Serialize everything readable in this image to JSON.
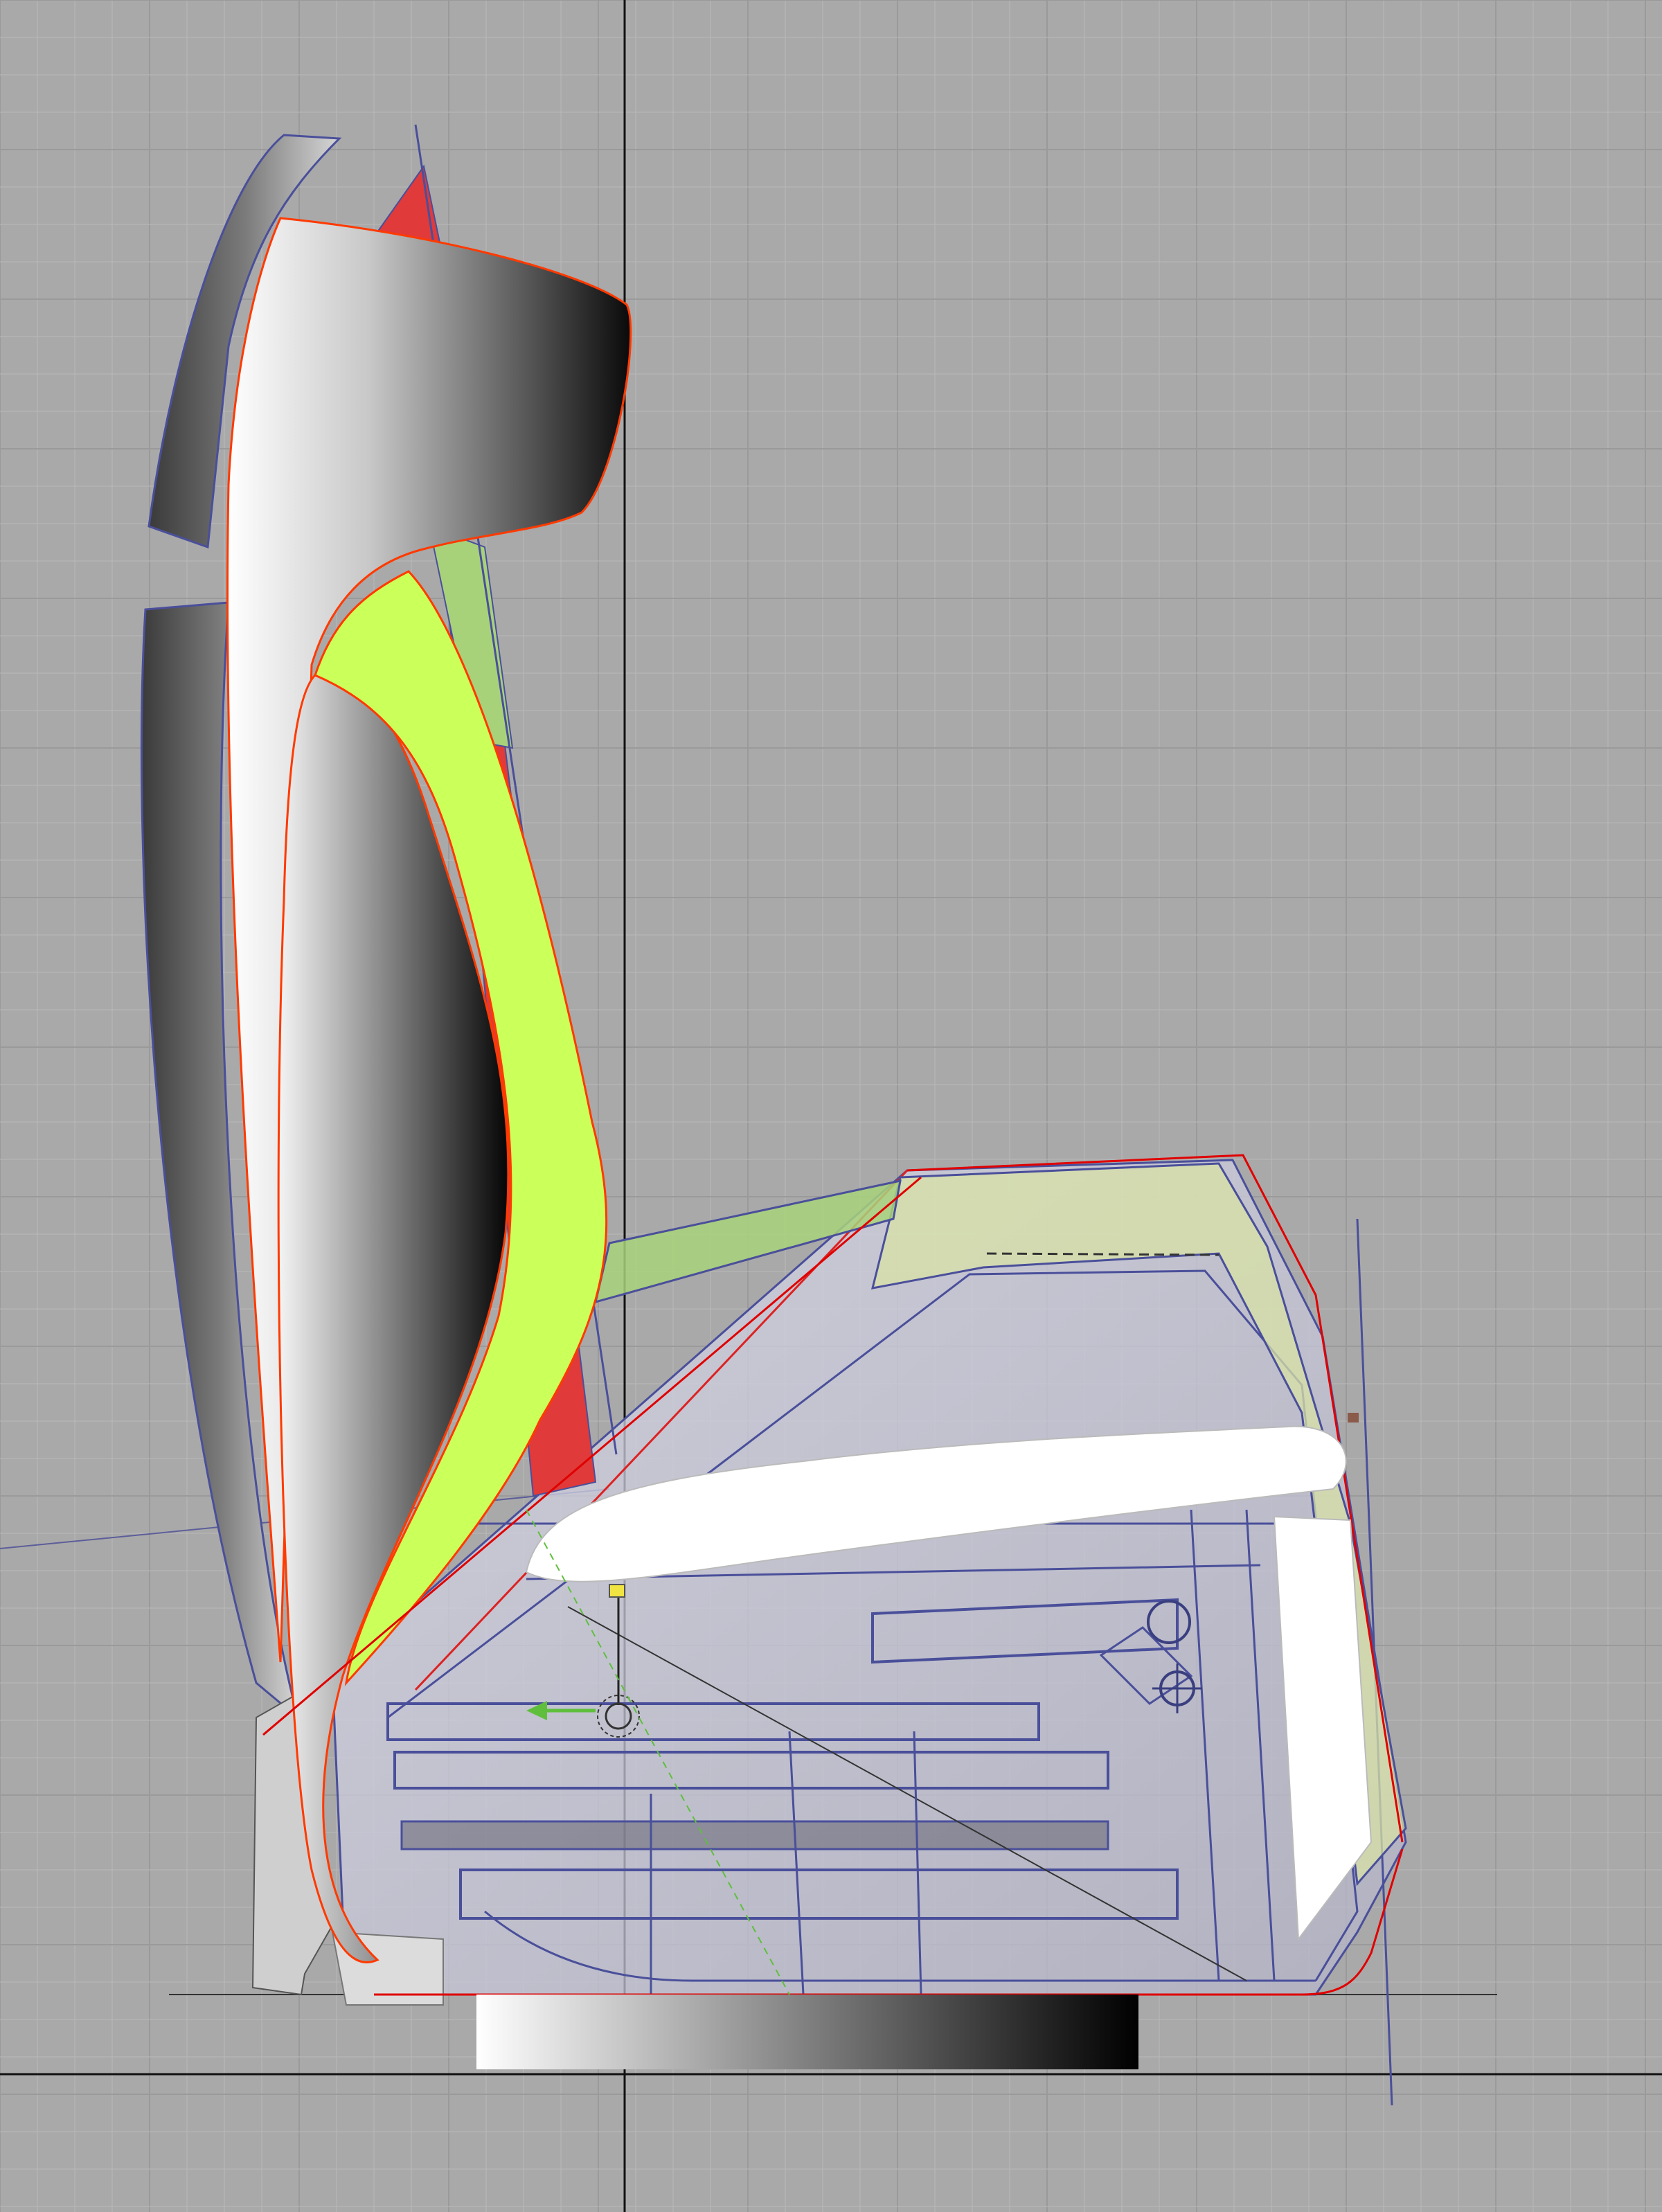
{
  "viewport": {
    "view": "side",
    "grid": true,
    "colors": {
      "background": "#a9a9a9",
      "grid_minor": "#b9b9b9",
      "grid_major": "#9a9a9a",
      "axis": "#111111",
      "selection_outline": "#ff3a00",
      "highlight_surface": "#cbff5a",
      "wire": "#4a4f9a",
      "red_panel": "#e03a3a",
      "green_panel": "#a8d27a"
    },
    "icons": [
      "pivot-gizmo-icon",
      "move-handle-icon",
      "gear-icon"
    ]
  }
}
